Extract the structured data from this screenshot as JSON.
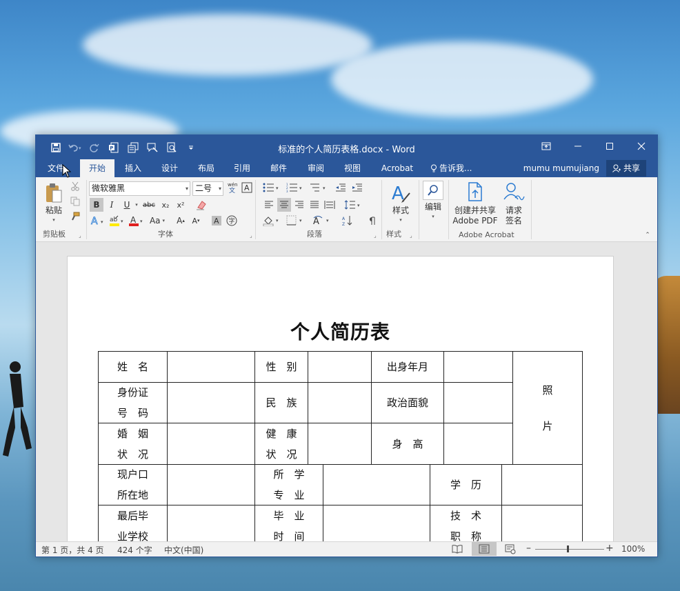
{
  "window": {
    "title": "标准的个人简历表格.docx - Word"
  },
  "quick_access": [
    "save-icon",
    "undo-icon",
    "redo-icon",
    "word-to-pdf-icon",
    "copy-format-icon",
    "comment-icon",
    "print-preview-icon",
    "customize-icon"
  ],
  "tabs": [
    "文件",
    "开始",
    "插入",
    "设计",
    "布局",
    "引用",
    "邮件",
    "审阅",
    "视图",
    "Acrobat"
  ],
  "active_tab": "开始",
  "tell_me": "告诉我...",
  "user": "mumu mumujiang",
  "share": "共享",
  "ribbon": {
    "clipboard": {
      "paste": "粘贴",
      "label": "剪贴板"
    },
    "font": {
      "name": "微软雅黑",
      "size": "二号",
      "label": "字体",
      "bold": "B",
      "italic": "I",
      "underline": "U",
      "strike": "abc",
      "subscript": "x₂",
      "superscript": "x²",
      "case": "Aa",
      "grow": "A",
      "shrink": "A"
    },
    "paragraph": {
      "label": "段落"
    },
    "styles": {
      "button": "样式",
      "label": "样式"
    },
    "editing": {
      "button": "编辑"
    },
    "adobe": {
      "create_line1": "创建并共享",
      "create_line2": "Adobe PDF",
      "sign_line1": "请求",
      "sign_line2": "签名",
      "label": "Adobe Acrobat"
    }
  },
  "document": {
    "title": "个人简历表",
    "table": {
      "name": "姓　名",
      "gender": "性　别",
      "birth": "出身年月",
      "photo1": "照",
      "photo2": "片",
      "id1": "身份证",
      "id2": "号　码",
      "ethnic": "民　族",
      "political": "政治面貌",
      "marriage1": "婚　姻",
      "marriage2": "状　况",
      "health1": "健　康",
      "health2": "状　况",
      "height": "身　高",
      "hukou1": "现户口",
      "hukou2": "所在地",
      "major1": "所　学",
      "major2": "专　业",
      "education": "学　历",
      "school1": "最后毕",
      "school2": "业学校",
      "grad1": "毕　业",
      "grad2": "时　间",
      "title1": "技　术",
      "title2": "职　称"
    }
  },
  "status": {
    "page": "第 1 页，共 4 页",
    "words": "424 个字",
    "language": "中文(中国)",
    "zoom": "100%"
  }
}
